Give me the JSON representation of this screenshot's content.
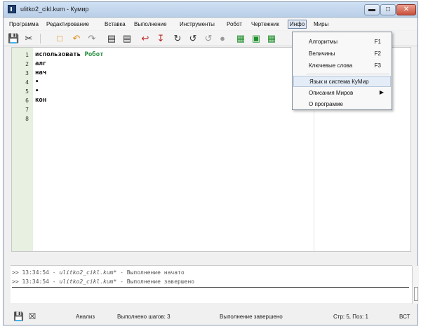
{
  "window": {
    "title": "ulitko2_cikl.kum - Кумир",
    "minimize_label": "▬",
    "maximize_label": "□",
    "close_label": "✕"
  },
  "menu": {
    "items": [
      {
        "label": "Программа"
      },
      {
        "label": "Редактирование"
      },
      {
        "label": "Вставка"
      },
      {
        "label": "Выполнение"
      },
      {
        "label": "Инструменты"
      },
      {
        "label": "Робот"
      },
      {
        "label": "Чертежник"
      },
      {
        "label": "Инфо"
      },
      {
        "label": "Миры"
      }
    ],
    "active": "Инфо"
  },
  "toolbar": {
    "icons": [
      "save-icon",
      "cut-icon",
      "paste-icon",
      "undo-icon",
      "redo-icon",
      "outdent-icon",
      "indent-icon",
      "step-over-icon",
      "step-into-icon",
      "step-out-icon",
      "run-icon",
      "run-step-icon",
      "stop-icon",
      "robot-window-icon",
      "robot-green-icon",
      "draw-green-icon"
    ],
    "colors": {
      "green_button": "#1e8f2a",
      "orange_accent": "#e09020"
    }
  },
  "editor": {
    "line_numbers": [
      "1",
      "2",
      "3",
      "4",
      "5",
      "6",
      "7",
      "8"
    ],
    "lines": [
      {
        "kw": "использовать ",
        "rest": "Робот"
      },
      {
        "kw": "алг",
        "rest": ""
      },
      {
        "kw": "нач",
        "rest": ""
      },
      {
        "kw": "•",
        "rest": ""
      },
      {
        "kw": "•",
        "rest": ""
      },
      {
        "kw": "кон",
        "rest": ""
      },
      {
        "kw": "",
        "rest": ""
      },
      {
        "kw": "",
        "rest": ""
      }
    ],
    "colors": {
      "gutter": "#e7f0e1",
      "keyword_green": "#1f8a3a"
    }
  },
  "console": {
    "lines": [
      {
        "prefix": ">> 13:34:54 - ",
        "file": "ulitko2_cikl.kum*",
        "suffix": " - Выполнение начато"
      },
      {
        "prefix": ">> 13:34:54 - ",
        "file": "ulitko2_cikl.kum*",
        "suffix": " - Выполнение завершено"
      }
    ]
  },
  "status": {
    "mode": "Анализ",
    "steps": "Выполнено шагов: 3",
    "state": "Выполнение завершено",
    "position": "Стр: 5, Поз: 1",
    "insert_mode": "ВСТ"
  },
  "info_menu": {
    "items": [
      {
        "label": "Алгоритмы",
        "shortcut": "F1"
      },
      {
        "label": "Величины",
        "shortcut": "F2"
      },
      {
        "label": "Ключевые слова",
        "shortcut": "F3"
      },
      {
        "label": "Язык и система КуМир",
        "shortcut": ""
      },
      {
        "label": "Описания Миров",
        "submenu_arrow": "▶"
      },
      {
        "label": "О программе",
        "shortcut": ""
      }
    ],
    "highlighted": "Язык и система КуМир"
  }
}
